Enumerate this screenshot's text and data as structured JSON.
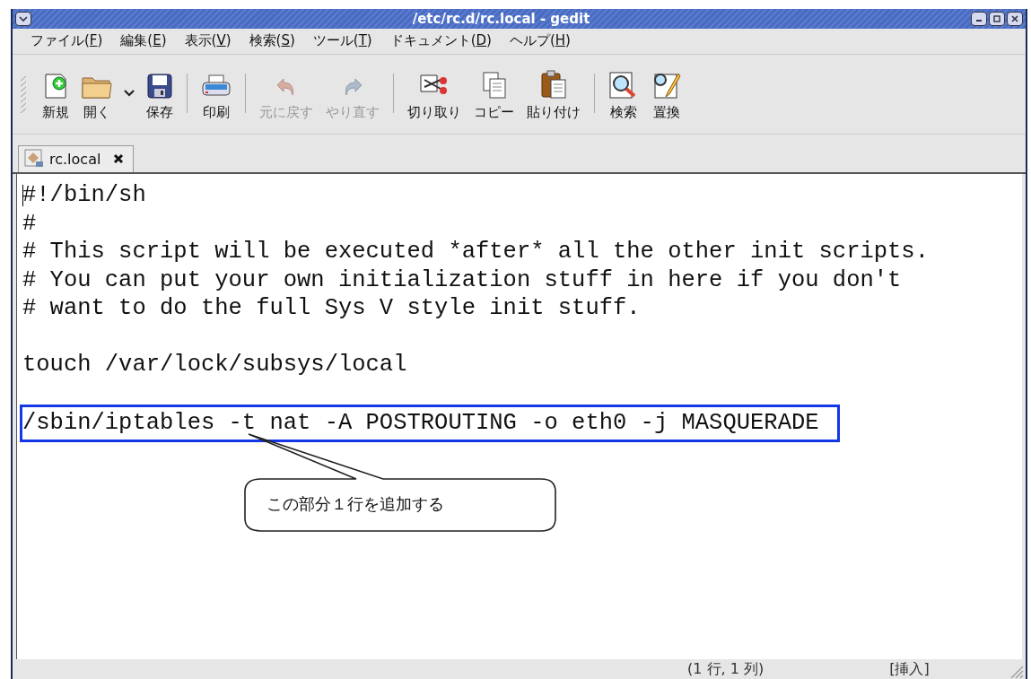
{
  "window": {
    "title": "/etc/rc.d/rc.local - gedit"
  },
  "menu": [
    {
      "pre": "ファイル(",
      "key": "F",
      "post": ")"
    },
    {
      "pre": "編集(",
      "key": "E",
      "post": ")"
    },
    {
      "pre": "表示(",
      "key": "V",
      "post": ")"
    },
    {
      "pre": "検索(",
      "key": "S",
      "post": ")"
    },
    {
      "pre": "ツール(",
      "key": "T",
      "post": ")"
    },
    {
      "pre": "ドキュメント(",
      "key": "D",
      "post": ")"
    },
    {
      "pre": "ヘルプ(",
      "key": "H",
      "post": ")"
    }
  ],
  "toolbar": [
    [
      {
        "label": "新規",
        "disabled": false
      },
      {
        "label": "開く",
        "disabled": false
      },
      {
        "label": "保存",
        "disabled": false
      }
    ],
    [
      {
        "label": "印刷",
        "disabled": false
      }
    ],
    [
      {
        "label": "元に戻す",
        "disabled": true
      },
      {
        "label": "やり直す",
        "disabled": true
      }
    ],
    [
      {
        "label": "切り取り",
        "disabled": false
      },
      {
        "label": "コピー",
        "disabled": false
      },
      {
        "label": "貼り付け",
        "disabled": false
      }
    ],
    [
      {
        "label": "検索",
        "disabled": false
      },
      {
        "label": "置換",
        "disabled": false
      }
    ]
  ],
  "tabs": [
    {
      "label": "rc.local",
      "selected": true
    }
  ],
  "editor": {
    "lines": [
      {
        "kind": "code",
        "text": "#!/bin/sh",
        "highlighted": false
      },
      {
        "kind": "code",
        "text": "#",
        "highlighted": false
      },
      {
        "kind": "code",
        "text": "# This script will be executed *after* all the other init scripts.",
        "highlighted": false
      },
      {
        "kind": "code",
        "text": "# You can put your own initialization stuff in here if you don't",
        "highlighted": false
      },
      {
        "kind": "code",
        "text": "# want to do the full Sys V style init stuff.",
        "highlighted": false
      },
      {
        "kind": "blank"
      },
      {
        "kind": "code",
        "text": "touch /var/lock/subsys/local",
        "highlighted": false
      },
      {
        "kind": "blank"
      },
      {
        "kind": "code",
        "text": "/sbin/iptables -t nat -A POSTROUTING -o eth0 -j MASQUERADE",
        "highlighted": true
      }
    ],
    "annotation": {
      "text": "この部分１行を追加する"
    }
  },
  "status_bar": {
    "position": "(1 行, 1 列)",
    "mode": "[挿入]"
  }
}
